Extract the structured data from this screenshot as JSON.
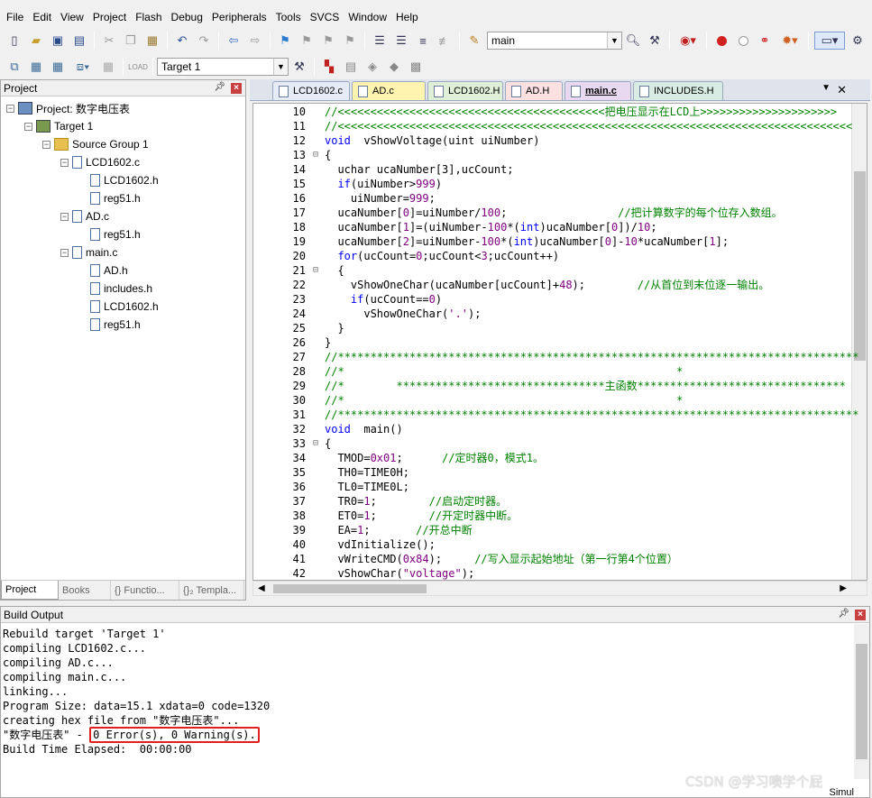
{
  "menu": [
    "File",
    "Edit",
    "View",
    "Project",
    "Flash",
    "Debug",
    "Peripherals",
    "Tools",
    "SVCS",
    "Window",
    "Help"
  ],
  "toolbar": {
    "find_value": "main",
    "target_value": "Target 1"
  },
  "project_panel": {
    "title": "Project",
    "tree": [
      {
        "label": "Project: 数字电压表",
        "level": 0,
        "icon": "project-icon",
        "expander": "-"
      },
      {
        "label": "Target 1",
        "level": 1,
        "icon": "target-icon",
        "expander": "-"
      },
      {
        "label": "Source Group 1",
        "level": 2,
        "icon": "folder-icon",
        "expander": "-"
      },
      {
        "label": "LCD1602.c",
        "level": 3,
        "icon": "file-icon",
        "expander": "-"
      },
      {
        "label": "LCD1602.h",
        "level": 4,
        "icon": "file-icon",
        "expander": ""
      },
      {
        "label": "reg51.h",
        "level": 4,
        "icon": "file-icon",
        "expander": ""
      },
      {
        "label": "AD.c",
        "level": 3,
        "icon": "file-icon",
        "expander": "-"
      },
      {
        "label": "reg51.h",
        "level": 4,
        "icon": "file-icon",
        "expander": ""
      },
      {
        "label": "main.c",
        "level": 3,
        "icon": "file-icon",
        "expander": "-"
      },
      {
        "label": "AD.h",
        "level": 4,
        "icon": "file-icon",
        "expander": ""
      },
      {
        "label": "includes.h",
        "level": 4,
        "icon": "file-icon",
        "expander": ""
      },
      {
        "label": "LCD1602.h",
        "level": 4,
        "icon": "file-icon",
        "expander": ""
      },
      {
        "label": "reg51.h",
        "level": 4,
        "icon": "file-icon",
        "expander": ""
      }
    ],
    "tabs": [
      "Project",
      "Books",
      "{} Functio...",
      "{}₂ Templa..."
    ]
  },
  "editor": {
    "tabs": [
      {
        "label": "LCD1602.c",
        "color": "#e6ecf6"
      },
      {
        "label": "AD.c",
        "color": "#fff3b0"
      },
      {
        "label": "LCD1602.H",
        "color": "#e0f0d8"
      },
      {
        "label": "AD.H",
        "color": "#fde0e0"
      },
      {
        "label": "main.c",
        "color": "#e8d8f0",
        "active": true
      },
      {
        "label": "INCLUDES.H",
        "color": "#d8ece4"
      }
    ],
    "lines": [
      {
        "n": "10",
        "f": "",
        "t": [
          [
            "cm",
            "//<<<<<<<<<<<<<<<<<<<<<<<<<<<<<<<<<<<<<<<<<把电压显示在LCD上>>>>>>>>>>>>>>>>>>>>>"
          ]
        ]
      },
      {
        "n": "11",
        "f": "",
        "t": [
          [
            "cm",
            "//<<<<<<<<<<<<<<<<<<<<<<<<<<<<<<<<<<<<<<<<<<<<<<<<<<<<<<<<<<<<<<<<<<<<<<<<<<<<<<<"
          ]
        ]
      },
      {
        "n": "12",
        "f": "",
        "t": [
          [
            "kw",
            "void"
          ],
          [
            "",
            "  vShowVoltage(uint uiNumber)"
          ]
        ]
      },
      {
        "n": "13",
        "f": "⊟",
        "t": [
          [
            "",
            "{"
          ]
        ]
      },
      {
        "n": "14",
        "f": "",
        "t": [
          [
            "",
            "  uchar ucaNumber[3],ucCount;"
          ]
        ]
      },
      {
        "n": "15",
        "f": "",
        "t": [
          [
            "",
            "  "
          ],
          [
            "kw",
            "if"
          ],
          [
            "",
            "(uiNumber>"
          ],
          [
            "nm",
            "999"
          ],
          [
            "",
            ")"
          ]
        ]
      },
      {
        "n": "16",
        "f": "",
        "t": [
          [
            "",
            "    uiNumber="
          ],
          [
            "nm",
            "999"
          ],
          [
            "",
            ";"
          ]
        ]
      },
      {
        "n": "17",
        "f": "",
        "t": [
          [
            "",
            "  ucaNumber["
          ],
          [
            "nm",
            "0"
          ],
          [
            "",
            "]=uiNumber/"
          ],
          [
            "nm",
            "100"
          ],
          [
            "",
            ";                 "
          ],
          [
            "cm",
            "//把计算数字的每个位存入数组。"
          ]
        ]
      },
      {
        "n": "18",
        "f": "",
        "t": [
          [
            "",
            "  ucaNumber["
          ],
          [
            "nm",
            "1"
          ],
          [
            "",
            "]=(uiNumber-"
          ],
          [
            "nm",
            "100"
          ],
          [
            "",
            "*("
          ],
          [
            "kw",
            "int"
          ],
          [
            "",
            ")ucaNumber["
          ],
          [
            "nm",
            "0"
          ],
          [
            "",
            "])/"
          ],
          [
            "nm",
            "10"
          ],
          [
            "",
            ";"
          ]
        ]
      },
      {
        "n": "19",
        "f": "",
        "t": [
          [
            "",
            "  ucaNumber["
          ],
          [
            "nm",
            "2"
          ],
          [
            "",
            "]=uiNumber-"
          ],
          [
            "nm",
            "100"
          ],
          [
            "",
            "*("
          ],
          [
            "kw",
            "int"
          ],
          [
            "",
            ")ucaNumber["
          ],
          [
            "nm",
            "0"
          ],
          [
            "",
            "]-"
          ],
          [
            "nm",
            "10"
          ],
          [
            "",
            "*ucaNumber["
          ],
          [
            "nm",
            "1"
          ],
          [
            "",
            "];"
          ]
        ]
      },
      {
        "n": "20",
        "f": "",
        "t": [
          [
            "",
            "  "
          ],
          [
            "kw",
            "for"
          ],
          [
            "",
            "(ucCount="
          ],
          [
            "nm",
            "0"
          ],
          [
            "",
            ";ucCount<"
          ],
          [
            "nm",
            "3"
          ],
          [
            "",
            ";ucCount++)"
          ]
        ]
      },
      {
        "n": "21",
        "f": "⊟",
        "t": [
          [
            "",
            "  {"
          ]
        ]
      },
      {
        "n": "22",
        "f": "",
        "t": [
          [
            "",
            "    vShowOneChar(ucaNumber[ucCount]+"
          ],
          [
            "nm",
            "48"
          ],
          [
            "",
            ");        "
          ],
          [
            "cm",
            "//从首位到末位逐一输出。"
          ]
        ]
      },
      {
        "n": "23",
        "f": "",
        "t": [
          [
            "",
            "    "
          ],
          [
            "kw",
            "if"
          ],
          [
            "",
            "(ucCount=="
          ],
          [
            "nm",
            "0"
          ],
          [
            "",
            ")"
          ]
        ]
      },
      {
        "n": "24",
        "f": "",
        "t": [
          [
            "",
            "      vShowOneChar("
          ],
          [
            "st",
            "'.'"
          ],
          [
            "",
            ");"
          ]
        ]
      },
      {
        "n": "25",
        "f": "",
        "t": [
          [
            "",
            "  }"
          ]
        ]
      },
      {
        "n": "26",
        "f": "",
        "t": [
          [
            "",
            "}"
          ]
        ]
      },
      {
        "n": "27",
        "f": "",
        "t": [
          [
            "cm",
            "//********************************************************************************"
          ]
        ]
      },
      {
        "n": "28",
        "f": "",
        "t": [
          [
            "cm",
            "//*                                                   *"
          ]
        ]
      },
      {
        "n": "29",
        "f": "",
        "t": [
          [
            "cm",
            "//*        ********************************主函数********************************"
          ]
        ]
      },
      {
        "n": "30",
        "f": "",
        "t": [
          [
            "cm",
            "//*                                                   *"
          ]
        ]
      },
      {
        "n": "31",
        "f": "",
        "t": [
          [
            "cm",
            "//********************************************************************************"
          ]
        ]
      },
      {
        "n": "32",
        "f": "",
        "t": [
          [
            "kw",
            "void"
          ],
          [
            "",
            "  main()"
          ]
        ]
      },
      {
        "n": "33",
        "f": "⊟",
        "t": [
          [
            "",
            "{"
          ]
        ]
      },
      {
        "n": "34",
        "f": "",
        "t": [
          [
            "",
            "  TMOD="
          ],
          [
            "nm",
            "0x01"
          ],
          [
            "",
            ";      "
          ],
          [
            "cm",
            "//定时器0，模式1。"
          ]
        ]
      },
      {
        "n": "35",
        "f": "",
        "t": [
          [
            "",
            "  TH0=TIME0H;"
          ]
        ]
      },
      {
        "n": "36",
        "f": "",
        "t": [
          [
            "",
            "  TL0=TIME0L;"
          ]
        ]
      },
      {
        "n": "37",
        "f": "",
        "t": [
          [
            "",
            "  TR0="
          ],
          [
            "nm",
            "1"
          ],
          [
            "",
            ";        "
          ],
          [
            "cm",
            "//启动定时器。"
          ]
        ]
      },
      {
        "n": "38",
        "f": "",
        "t": [
          [
            "",
            "  ET0="
          ],
          [
            "nm",
            "1"
          ],
          [
            "",
            ";        "
          ],
          [
            "cm",
            "//开定时器中断。"
          ]
        ]
      },
      {
        "n": "39",
        "f": "",
        "t": [
          [
            "",
            "  EA="
          ],
          [
            "nm",
            "1"
          ],
          [
            "",
            ";       "
          ],
          [
            "cm",
            "//开总中断"
          ]
        ]
      },
      {
        "n": "40",
        "f": "",
        "t": [
          [
            "",
            "  vdInitialize();"
          ]
        ]
      },
      {
        "n": "41",
        "f": "",
        "t": [
          [
            "",
            "  vWriteCMD("
          ],
          [
            "nm",
            "0x84"
          ],
          [
            "",
            ");     "
          ],
          [
            "cm",
            "//写入显示起始地址（第一行第4个位置）"
          ]
        ]
      },
      {
        "n": "42",
        "f": "",
        "t": [
          [
            "",
            "  vShowChar("
          ],
          [
            "st",
            "\"voltage\""
          ],
          [
            "",
            ");"
          ]
        ]
      }
    ]
  },
  "build_output": {
    "title": "Build Output",
    "lines": [
      "Rebuild target 'Target 1'",
      "compiling LCD1602.c...",
      "compiling AD.c...",
      "compiling main.c...",
      "linking...",
      "Program Size: data=15.1 xdata=0 code=1320",
      "creating hex file from \"数字电压表\"..."
    ],
    "result_prefix": "\"数字电压表\" - ",
    "result_highlight": "0 Error(s), 0 Warning(s).",
    "elapsed": "Build Time Elapsed:  00:00:00"
  },
  "watermark": "CSDN @学习噢学个屁",
  "status_text": "Simul"
}
